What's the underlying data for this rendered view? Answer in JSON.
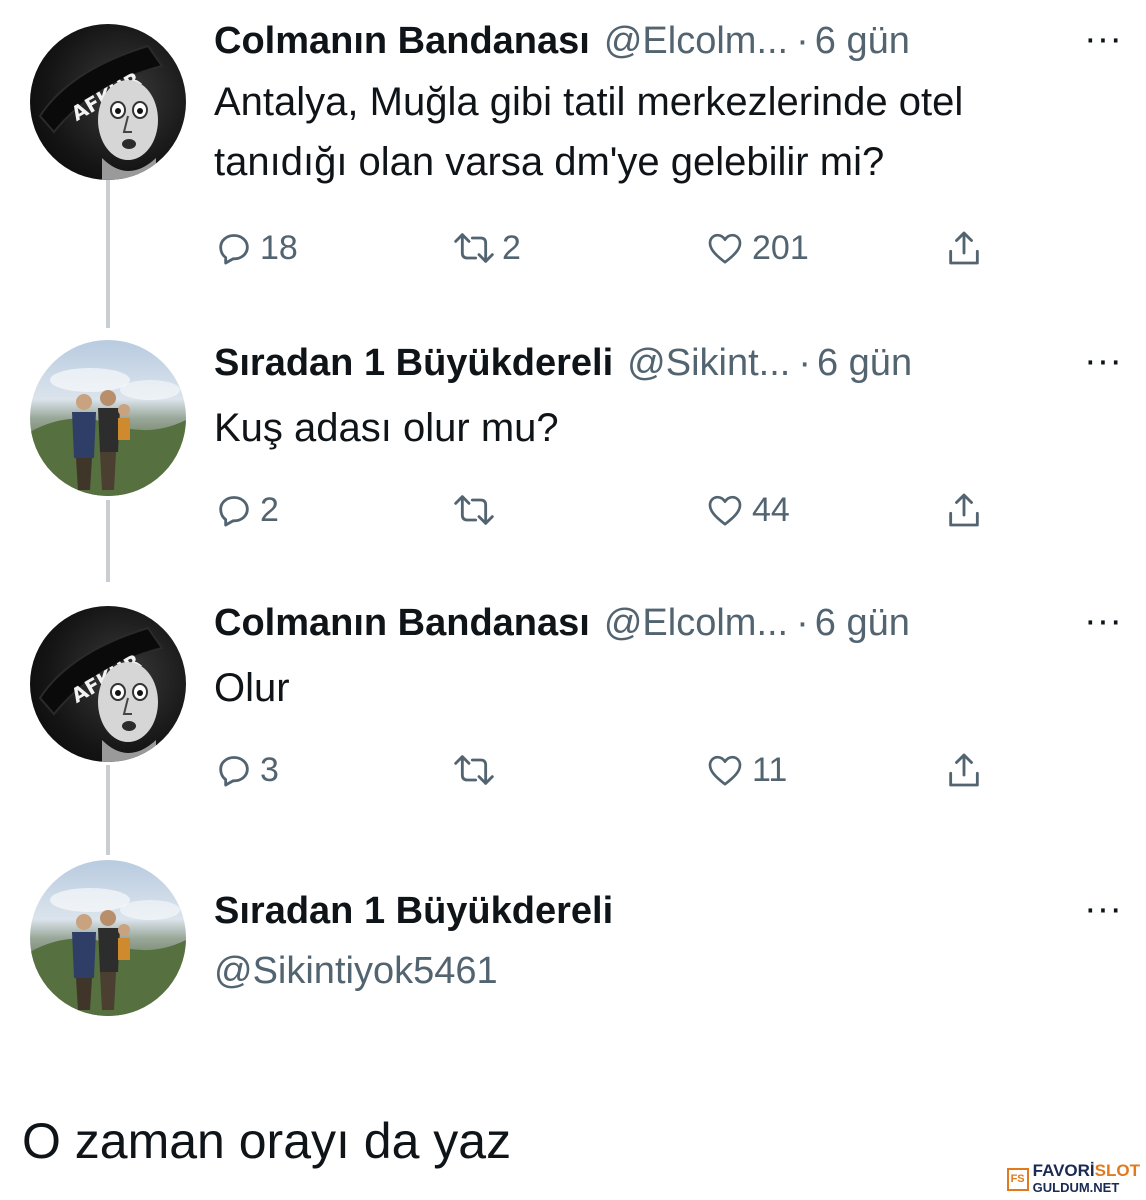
{
  "tweets": [
    {
      "name": "Colmanın Bandanası",
      "handle": "@Elcolm...",
      "dot": "·",
      "time": "6 gün",
      "more": "···",
      "avatar_text": "AFKUR",
      "text_lines": [
        "Antalya, Muğla gibi tatil merkezlerinde otel",
        "tanıdığı olan varsa dm'ye gelebilir mi?"
      ],
      "replies": "18",
      "retweets": "2",
      "likes": "201"
    },
    {
      "name": "Sıradan 1 Büyükdereli",
      "handle": "@Sikint...",
      "dot": "·",
      "time": "6 gün",
      "more": "···",
      "text_lines": [
        "Kuş adası olur mu?"
      ],
      "replies": "2",
      "retweets": "",
      "likes": "44"
    },
    {
      "name": "Colmanın Bandanası",
      "handle": "@Elcolm...",
      "dot": "·",
      "time": "6 gün",
      "more": "···",
      "avatar_text": "AFKUR",
      "text_lines": [
        "Olur"
      ],
      "replies": "3",
      "retweets": "",
      "likes": "11"
    }
  ],
  "compose": {
    "name": "Sıradan 1 Büyükdereli",
    "handle": "@Sikintiyok5461",
    "more": "···"
  },
  "caption": "O zaman orayı da yaz",
  "watermark": {
    "box": "FS",
    "line1_a": "FAVORİ",
    "line1_b": "SLOT",
    "line2": "GULDUM.NET"
  },
  "icons": [
    "reply-icon",
    "retweet-icon",
    "like-icon",
    "share-icon",
    "more-icon"
  ],
  "colors": {
    "text": "#0f1419",
    "secondary": "#536471",
    "thread_line": "#c9ced3",
    "watermark_orange": "#e07a1c"
  }
}
